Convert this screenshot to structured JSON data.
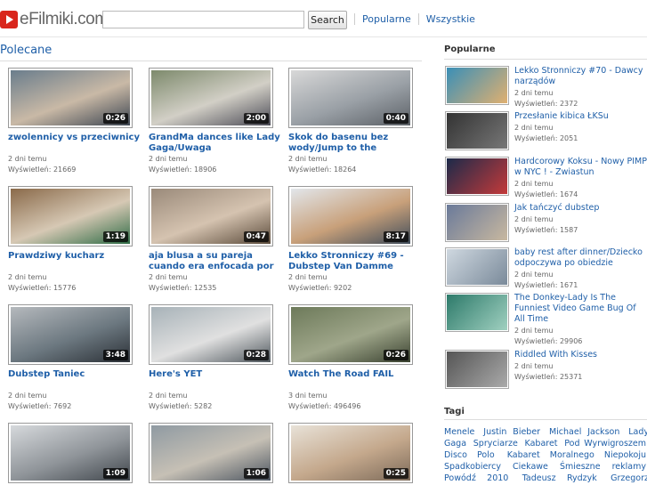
{
  "header": {
    "logo_text": "eFilmiki.com",
    "search_placeholder": "",
    "search_label": "Search",
    "nav": [
      "Popularne",
      "Wszystkie"
    ]
  },
  "main": {
    "section_title": "Polecane",
    "videos": [
      {
        "title": "zwolennicy vs przeciwnicy",
        "duration": "0:26",
        "age": "2 dni temu",
        "views": "Wyświetleń: 21669"
      },
      {
        "title": "GrandMa dances like Lady Gaga/Uwaga",
        "duration": "2:00",
        "age": "2 dni temu",
        "views": "Wyświetleń: 18906"
      },
      {
        "title": "Skok do basenu bez wody/Jump to the",
        "duration": "0:40",
        "age": "2 dni temu",
        "views": "Wyświetleń: 18264"
      },
      {
        "title": "Prawdziwy kucharz",
        "duration": "1:19",
        "age": "2 dni temu",
        "views": "Wyświetleń: 15776"
      },
      {
        "title": "aja blusa a su pareja cuando era enfocada por",
        "duration": "0:47",
        "age": "2 dni temu",
        "views": "Wyświetleń: 12535"
      },
      {
        "title": "Lekko Stronniczy #69 - Dubstep Van Damme",
        "duration": "8:17",
        "age": "2 dni temu",
        "views": "Wyświetleń: 9202"
      },
      {
        "title": "Dubstep Taniec",
        "duration": "3:48",
        "age": "2 dni temu",
        "views": "Wyświetleń: 7692"
      },
      {
        "title": "Here's YET",
        "duration": "0:28",
        "age": "2 dni temu",
        "views": "Wyświetleń: 5282"
      },
      {
        "title": "Watch The Road FAIL",
        "duration": "0:26",
        "age": "3 dni temu",
        "views": "Wyświetleń: 496496"
      },
      {
        "title": "",
        "duration": "1:09",
        "age": "",
        "views": ""
      },
      {
        "title": "",
        "duration": "1:06",
        "age": "",
        "views": ""
      },
      {
        "title": "",
        "duration": "0:25",
        "age": "",
        "views": ""
      }
    ]
  },
  "sidebar": {
    "title": "Popularne",
    "items": [
      {
        "title": "Lekko Stronniczy #70 - Dawcy narządów",
        "age": "2 dni temu",
        "views": "Wyświetleń: 2372"
      },
      {
        "title": "Przesłanie kibica ŁKSu",
        "age": "2 dni temu",
        "views": "Wyświetleń: 2051"
      },
      {
        "title": "Hardcorowy Koksu - Nowy PIMP w NYC ! - Zwiastun",
        "age": "2 dni temu",
        "views": "Wyświetleń: 1674"
      },
      {
        "title": "Jak tańczyć dubstep",
        "age": "2 dni temu",
        "views": "Wyświetleń: 1587"
      },
      {
        "title": "baby rest after dinner/Dziecko odpoczywa po obiedzie",
        "age": "2 dni temu",
        "views": "Wyświetleń: 1671"
      },
      {
        "title": "The Donkey-Lady Is The Funniest Video Game Bug Of All Time",
        "age": "2 dni temu",
        "views": "Wyświetleń: 29906"
      },
      {
        "title": "Riddled With Kisses",
        "age": "2 dni temu",
        "views": "Wyświetleń: 25371"
      }
    ],
    "tags_title": "Tagi",
    "tags": [
      "Menele",
      "Justin Bieber",
      "Michael Jackson",
      "Lady Gaga",
      "Spryciarze",
      "Kabaret",
      "Pod Wyrwigroszem",
      "Disco Polo",
      "Kabaret Moralnego Niepokoju",
      "Spadkobiercy",
      "Ciekawe",
      "Śmieszne",
      "reklamy",
      "Powódź 2010",
      "Tadeusz Rydzyk",
      "Grzegorz Halama"
    ]
  },
  "colors": {
    "link": "#1f5fa8",
    "logo_red": "#d9261c"
  }
}
